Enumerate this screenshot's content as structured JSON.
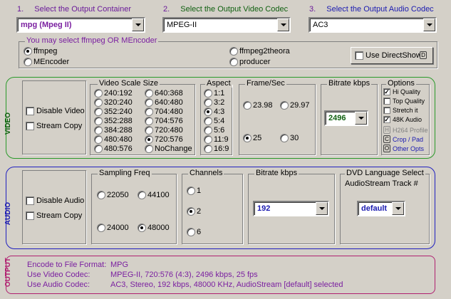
{
  "steps": {
    "container": {
      "num": "1.",
      "label": "Select the Output Container",
      "value": "mpg  (Mpeg II)"
    },
    "video_codec": {
      "num": "2.",
      "label": "Select the Output Video Codec",
      "value": "MPEG-II"
    },
    "audio_codec": {
      "num": "3.",
      "label": "Select the Output Audio Codec",
      "value": "AC3"
    }
  },
  "encoder": {
    "title": "You may select ffmpeg OR MEncoder",
    "options": [
      "ffmpeg",
      "MEncoder",
      "ffmpeg2theora",
      "producer"
    ],
    "selected": "ffmpeg",
    "directshow_label": "Use DirectShow",
    "directshow_key": "D"
  },
  "video": {
    "side_label": "VIDEO",
    "disable_label": "Disable Video",
    "stream_copy_label": "Stream Copy",
    "scale": {
      "title": "Video Scale Size",
      "col1": [
        "240:192",
        "320:240",
        "352:240",
        "352:288",
        "384:288",
        "480:480",
        "480:576"
      ],
      "col2": [
        "640:368",
        "640:480",
        "704:480",
        "704:576",
        "720:480",
        "720:576",
        "NoChange"
      ],
      "selected": "720:576"
    },
    "aspect": {
      "title": "Aspect",
      "options": [
        "1:1",
        "3:2",
        "4:3",
        "5:4",
        "5:6",
        "11:9",
        "16:9"
      ],
      "selected": "4:3"
    },
    "fps": {
      "title": "Frame/Sec",
      "options": [
        "23.98",
        "29.97",
        "25",
        "30"
      ],
      "selected": "25"
    },
    "bitrate": {
      "title": "Bitrate  kbps",
      "value": "2496"
    },
    "options": {
      "title": "Options",
      "checks": [
        {
          "label": "Hi Quality",
          "checked": true
        },
        {
          "label": "Top Quality",
          "checked": false
        },
        {
          "label": "Stretch it",
          "checked": false
        },
        {
          "label": "48K Audio",
          "checked": true
        }
      ],
      "keys": [
        {
          "key": "H",
          "label": "H264 Profile",
          "disabled": true
        },
        {
          "key": "C",
          "label": "Crop / Pad",
          "disabled": false
        },
        {
          "key": "O",
          "label": "Other Opts",
          "disabled": false
        }
      ]
    }
  },
  "audio": {
    "side_label": "AUDIO",
    "disable_label": "Disable Audio",
    "stream_copy_label": "Stream Copy",
    "sampling": {
      "title": "Sampling Freq",
      "options": [
        "22050",
        "44100",
        "24000",
        "48000"
      ],
      "selected": "48000"
    },
    "channels": {
      "title": "Channels",
      "options": [
        "1",
        "2",
        "6"
      ],
      "selected": "2"
    },
    "bitrate": {
      "title": "Bitrate  kbps",
      "value": "192"
    },
    "dvd": {
      "title": "DVD Language Select",
      "subtitle": "AudioStream  Track #",
      "value": "default"
    }
  },
  "output": {
    "side_label": "OUTPUT",
    "rows": [
      {
        "label": "Encode to File Format:",
        "value": "MPG"
      },
      {
        "label": "Use Video Codec:",
        "value": "MPEG-II,  720:576 (4:3),  2496 kbps,  25 fps"
      },
      {
        "label": "Use Audio Codec:",
        "value": "AC3,   Stereo,  192 kbps,   48000 KHz,   AudioStream [default] selected"
      }
    ]
  },
  "colors": {
    "video_border": "#2a9a2a",
    "audio_border": "#2020c0",
    "output_border": "#b02070",
    "label_purple": "#7a1fa0",
    "label_green": "#106010",
    "label_blue": "#1a1ab0"
  }
}
